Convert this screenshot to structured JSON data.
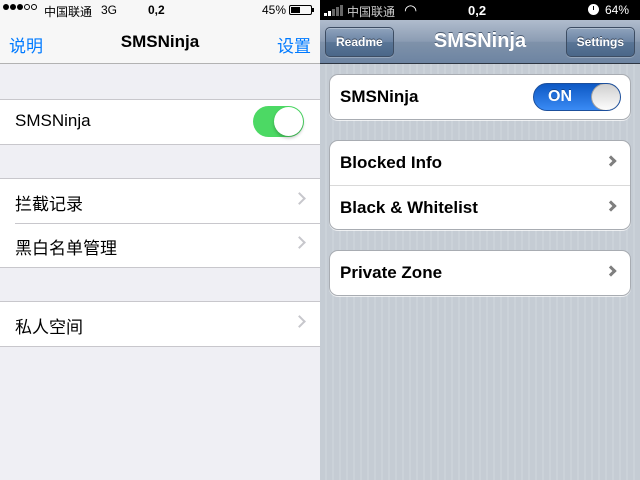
{
  "left_screen": {
    "status_bar": {
      "carrier": "中国联通",
      "network": "3G",
      "time": "0,2",
      "battery": "45%",
      "battery_level": 0.45
    },
    "nav": {
      "left_button": "说明",
      "title": "SMSNinja",
      "right_button": "设置"
    },
    "groups": {
      "main_toggle": {
        "label": "SMSNinja",
        "state": "on"
      },
      "lists": [
        "拦截记录",
        "黑白名单管理"
      ],
      "private": [
        "私人空间"
      ]
    }
  },
  "right_screen": {
    "status_bar": {
      "carrier": "中国联通",
      "time": "0,2",
      "battery": "64%"
    },
    "nav": {
      "left_button": "Readme",
      "title": "SMSNinja",
      "right_button": "Settings"
    },
    "groups": {
      "main_toggle": {
        "label": "SMSNinja",
        "state_text": "ON"
      },
      "lists": [
        "Blocked Info",
        "Black & Whitelist"
      ],
      "private": [
        "Private Zone"
      ]
    }
  },
  "colors": {
    "ios7_accent": "#007aff",
    "ios7_toggle_on": "#4cd964",
    "ios6_toggle_on": "#1a6fe0",
    "ios6_navbar": "#7f92aa"
  }
}
